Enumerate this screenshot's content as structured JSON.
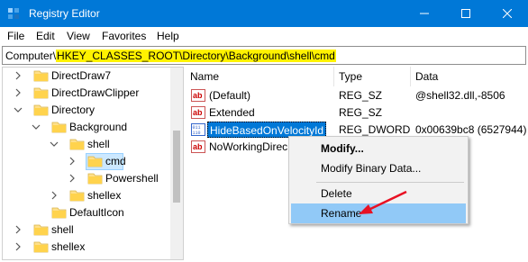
{
  "window": {
    "title": "Registry Editor",
    "controls": {
      "minimize": "minimize-icon",
      "maximize": "maximize-icon",
      "close": "close-icon"
    }
  },
  "menu": [
    "File",
    "Edit",
    "View",
    "Favorites",
    "Help"
  ],
  "address": {
    "prefix": "Computer\\",
    "highlighted": "HKEY_CLASSES_ROOT\\Directory\\Background\\shell\\cmd"
  },
  "tree": [
    {
      "label": "DirectDraw7",
      "expander": "expand"
    },
    {
      "label": "DirectDrawClipper",
      "expander": "expand"
    },
    {
      "label": "Directory",
      "expander": "collapse"
    },
    {
      "label": "Background",
      "expander": "collapse"
    },
    {
      "label": "shell",
      "expander": "collapse"
    },
    {
      "label": "cmd",
      "expander": "expand",
      "selected": true
    },
    {
      "label": "Powershell",
      "expander": "expand"
    },
    {
      "label": "shellex",
      "expander": "expand"
    },
    {
      "label": "DefaultIcon",
      "expander": "none"
    },
    {
      "label": "shell",
      "expander": "expand"
    },
    {
      "label": "shellex",
      "expander": "expand"
    }
  ],
  "list": {
    "headers": {
      "name": "Name",
      "type": "Type",
      "data": "Data"
    },
    "rows": [
      {
        "name": "(Default)",
        "type": "REG_SZ",
        "data": "@shell32.dll,-8506",
        "icon": "ab"
      },
      {
        "name": "Extended",
        "type": "REG_SZ",
        "data": "",
        "icon": "ab"
      },
      {
        "name": "HideBasedOnVelocityId",
        "type": "REG_DWORD",
        "data": "0x00639bc8 (6527944)",
        "icon": "binary",
        "selected": true
      },
      {
        "name": "NoWorkingDirec",
        "type": "",
        "data": "",
        "icon": "ab"
      }
    ]
  },
  "context_menu": {
    "items": [
      "Modify...",
      "Modify Binary Data...",
      "Delete",
      "Rename"
    ],
    "highlighted": "Rename"
  },
  "colors": {
    "titlebar": "#0078d7",
    "highlight_yellow": "#fff200",
    "selection": "#0078d7",
    "hover": "#91c9f7",
    "arrow": "#e81123"
  }
}
